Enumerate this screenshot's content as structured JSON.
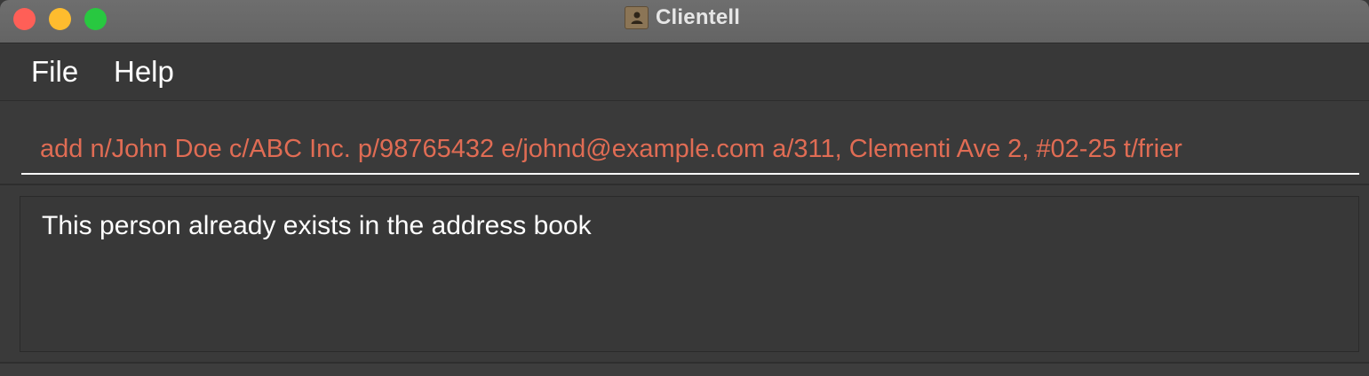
{
  "window": {
    "title": "Clientell",
    "app_icon": "address-book-icon"
  },
  "menu": {
    "items": [
      {
        "label": "File"
      },
      {
        "label": "Help"
      }
    ]
  },
  "command_box": {
    "value": "add n/John Doe c/ABC Inc. p/98765432 e/johnd@example.com a/311, Clementi Ave 2, #02-25 t/frier"
  },
  "result": {
    "message": "This person already exists in the address book"
  },
  "colors": {
    "command_text": "#e06c54",
    "background": "#3a3a3a",
    "titlebar": "#6a6a6a"
  }
}
